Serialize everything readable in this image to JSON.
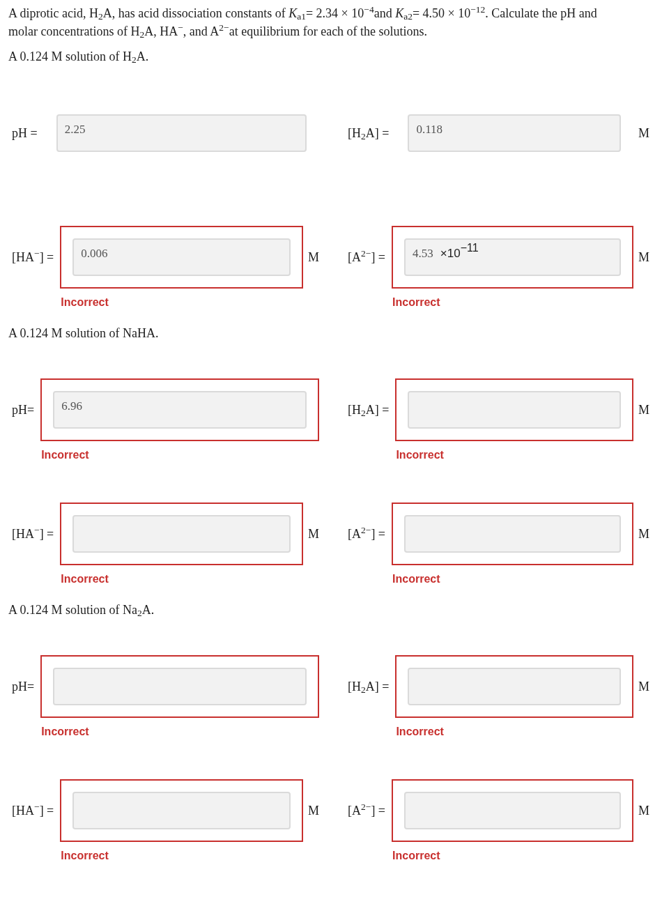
{
  "intro": "A diprotic acid, H$_{2}$A, has acid dissociation constants of *K*$_{a1}$= 2.34 × 10$^{−4}$and *K*$_{a2}$= 4.50 × 10$^{−12}$. Calculate the pH and molar concentrations of H$_{2}$A, HA$^{−}$, and A$^{2−}$at equilibrium for each of the solutions.",
  "sections": [
    {
      "heading": "A 0.124 M solution of H$_{2}$A.",
      "rows": [
        {
          "cells": [
            {
              "label": "pH =",
              "value": "2.25",
              "incorrect": false
            },
            {
              "label": "[H$_{2}$A] =",
              "value": "0.118",
              "unit": "M",
              "incorrect": false
            }
          ]
        },
        {
          "cells": [
            {
              "label": "[HA$^{−}$] =",
              "value": "0.006",
              "unit": "M",
              "incorrect": true,
              "feedback": "Incorrect"
            },
            {
              "label": "[A$^{2−}$] =",
              "value": "4.53",
              "multiplier": "×10",
              "exponent": "−11",
              "unit": "M",
              "incorrect": true,
              "feedback": "Incorrect"
            }
          ]
        }
      ]
    },
    {
      "heading": "A 0.124 M solution of NaHA.",
      "rows": [
        {
          "cells": [
            {
              "label": "pH=",
              "value": "6.96",
              "incorrect": true,
              "feedback": "Incorrect"
            },
            {
              "label": "[H$_{2}$A] =",
              "unit": "M",
              "incorrect": true,
              "feedback": "Incorrect"
            }
          ]
        },
        {
          "cells": [
            {
              "label": "[HA$^{−}$] =",
              "unit": "M",
              "incorrect": true,
              "feedback": "Incorrect"
            },
            {
              "label": "[A$^{2−}$] =",
              "unit": "M",
              "incorrect": true,
              "feedback": "Incorrect"
            }
          ]
        }
      ]
    },
    {
      "heading": "A 0.124 M solution of Na$_{2}$A.",
      "rows": [
        {
          "cells": [
            {
              "label": "pH=",
              "incorrect": true,
              "feedback": "Incorrect"
            },
            {
              "label": "[H$_{2}$A] =",
              "unit": "M",
              "incorrect": true,
              "feedback": "Incorrect"
            }
          ]
        },
        {
          "cells": [
            {
              "label": "[HA$^{−}$] =",
              "unit": "M",
              "incorrect": true,
              "feedback": "Incorrect"
            },
            {
              "label": "[A$^{2−}$] =",
              "unit": "M",
              "incorrect": true,
              "feedback": "Incorrect"
            }
          ]
        }
      ]
    }
  ]
}
